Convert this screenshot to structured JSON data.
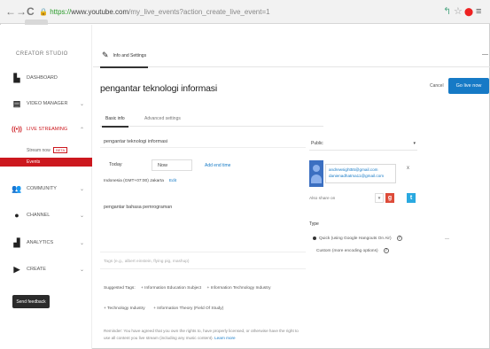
{
  "browser": {
    "back": "←",
    "forward": "→",
    "reload": "C",
    "address": {
      "lock": "🔒",
      "scheme": "https://",
      "host": "www.youtube.com",
      "path": "/my_live_events?action_create_live_event=1"
    },
    "extensions": [
      "↰",
      "☆",
      "⬤",
      "≡"
    ]
  },
  "sidebar": {
    "title": "CREATOR STUDIO",
    "items": [
      {
        "label": "DASHBOARD",
        "icon": "dashboard-icon"
      },
      {
        "label": "VIDEO MANAGER",
        "icon": "video-manager-icon"
      },
      {
        "label": "LIVE STREAMING",
        "icon": "live-streaming-icon"
      },
      {
        "label": "COMMUNITY",
        "icon": "community-icon"
      },
      {
        "label": "CHANNEL",
        "icon": "channel-icon"
      },
      {
        "label": "ANALYTICS",
        "icon": "analytics-icon"
      },
      {
        "label": "CREATE",
        "icon": "create-icon"
      }
    ],
    "sub": {
      "stream_now": "Stream now",
      "beta": "BETA",
      "events": "Events"
    },
    "feedback": "Send feedback"
  },
  "main": {
    "tab": "Info and Settings",
    "title": "pengantar teknologi informasi",
    "cancel": "Cancel",
    "golive": "Go live now",
    "subtabs": [
      "Basic info",
      "Advanced settings"
    ],
    "title_input": "pengantar teknologi informasi",
    "date_label": "Today",
    "time_value": "Now",
    "add_end": "Add end time",
    "timezone": "Indonesia (GMT+07:00) Jakarta",
    "edit": "Edit",
    "description": "pengantar bahasa pemrograman",
    "dash": "—",
    "tags_placeholder": "Tags (e.g., albert einstein, flying pig, mashup)",
    "suggested_label": "Suggested Tags:",
    "suggested_tags": [
      "+ Information Education Subject",
      "+ Information Technology Industry",
      "+ Technology Industry",
      "+ Information Theory (Field Of Study)"
    ],
    "reminder_pre": "Reminder: You have agreed that you own the rights to, have properly licensed, or otherwise have the right to use all content you live stream (including any music content).",
    "learn_more": "Learn more"
  },
  "right": {
    "privacy": "Public",
    "caret": "▾",
    "emails": [
      "andrewsight55@gmail.com",
      "danienadhatma11@gmail.com"
    ],
    "share_x": "x",
    "also_share": "Also share on",
    "type_heading": "Type",
    "quick": "Quick (using Google Hangouts On Air)",
    "custom": "Custom (more encoding options)"
  },
  "colors": {
    "brand_red": "#cc181e",
    "accent_blue": "#167ac6"
  }
}
